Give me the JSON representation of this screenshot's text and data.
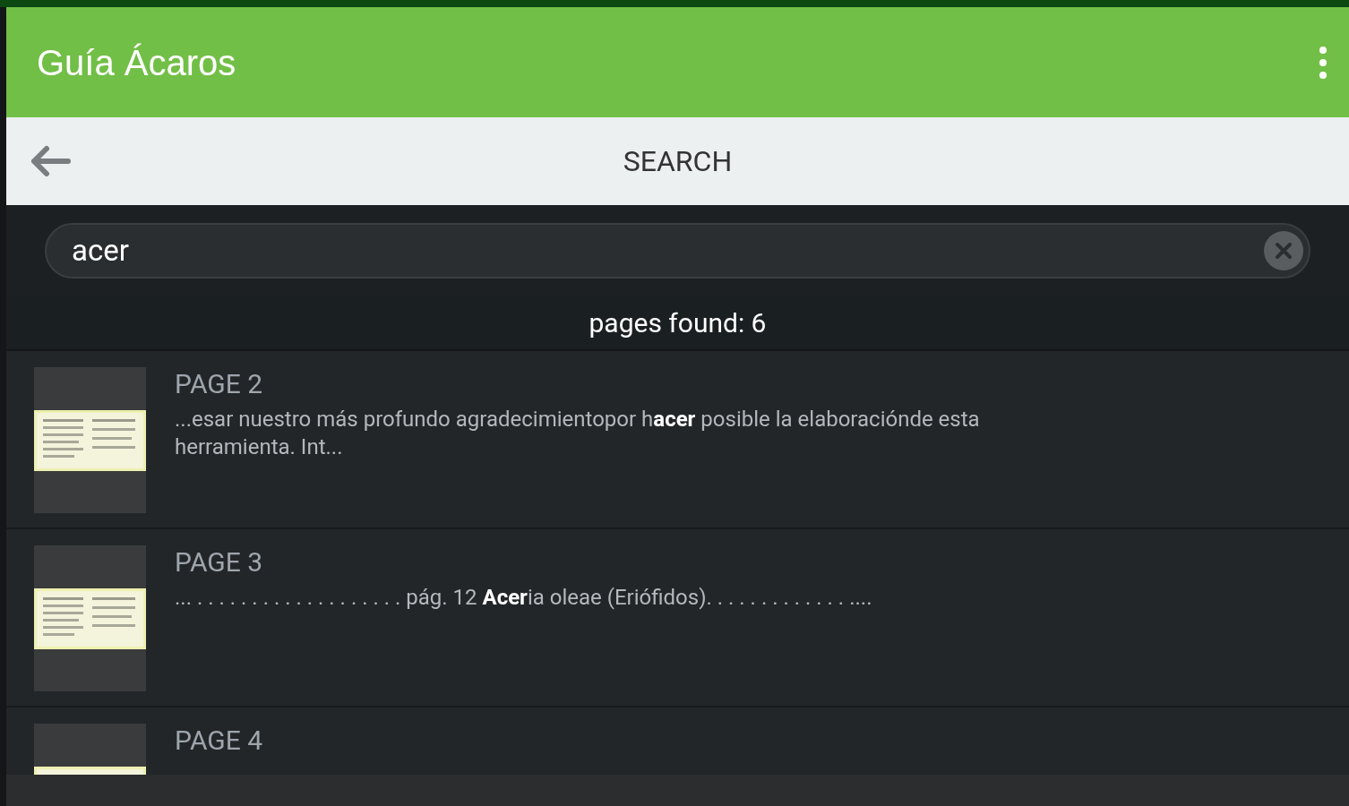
{
  "app_bar": {
    "title": "Guía Ácaros"
  },
  "toolbar": {
    "title": "SEARCH"
  },
  "search": {
    "value": "acer"
  },
  "results_header": "pages found: 6",
  "results": [
    {
      "page": "PAGE 2",
      "snippet": "...esar nuestro más profundo agradecimientopor h**acer** posible la elaboraciónde esta herramienta. Int..."
    },
    {
      "page": "PAGE 3",
      "snippet": "... . . . . . . . . . . . . . . . . . . . pág. 12 **Acer**ia oleae (Eriófidos). . . . . . . . . . . . . ...."
    },
    {
      "page": "PAGE 4"
    }
  ]
}
